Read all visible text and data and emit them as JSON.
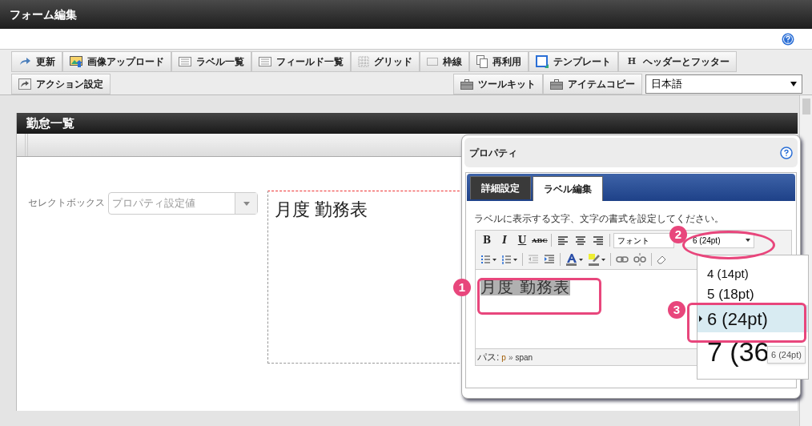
{
  "window": {
    "title": "フォーム編集"
  },
  "toolbar": {
    "row1": [
      {
        "label": "更新",
        "kind": "refresh"
      },
      {
        "label": "画像アップロード",
        "kind": "image"
      },
      {
        "label": "ラベル一覧",
        "kind": "list"
      },
      {
        "label": "フィールド一覧",
        "kind": "list"
      },
      {
        "label": "グリッド",
        "kind": "grid"
      },
      {
        "label": "枠線",
        "kind": "frame"
      },
      {
        "label": "再利用",
        "kind": "pages"
      },
      {
        "label": "テンプレート",
        "kind": "template"
      },
      {
        "label": "ヘッダーとフッター",
        "kind": "letter",
        "glyph": "H"
      }
    ],
    "row2_left": [
      {
        "label": "アクション設定",
        "kind": "share"
      }
    ],
    "row2_right": [
      {
        "label": "ツールキット",
        "kind": "toolbox"
      },
      {
        "label": "アイテムコピー",
        "kind": "toolbox"
      }
    ],
    "language": "日本語"
  },
  "form": {
    "title": "勤怠一覧",
    "select_label": "セレクトボックス",
    "select_placeholder": "プロパティ設定値",
    "label_text": "月度 勤務表"
  },
  "properties": {
    "title": "プロパティ",
    "tabs": [
      {
        "label": "詳細設定",
        "selected": false
      },
      {
        "label": "ラベル編集",
        "selected": true
      }
    ],
    "description": "ラベルに表示する文字、文字の書式を設定してください。",
    "format_buttons": [
      "B",
      "I",
      "U",
      "ABC"
    ],
    "font_select": "フォント",
    "size_select": "6 (24pt)",
    "editor_text": "月度 勤務表",
    "path_label": "パス:",
    "path": [
      "p",
      "span"
    ],
    "path_separator": "»",
    "size_options": [
      {
        "label": "4 (14pt)",
        "selected": false
      },
      {
        "label": "5 (18pt)",
        "selected": false
      },
      {
        "label": "6 (24pt)",
        "selected": true
      },
      {
        "label": "7 (36",
        "selected": false
      }
    ],
    "tooltip": "6 (24pt)"
  },
  "callouts": [
    {
      "number": "1"
    },
    {
      "number": "2"
    },
    {
      "number": "3"
    }
  ]
}
